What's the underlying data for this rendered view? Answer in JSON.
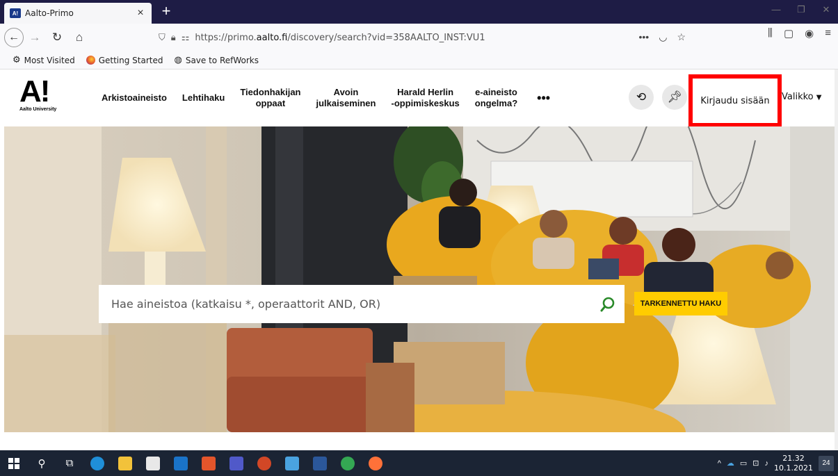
{
  "browser": {
    "tab_title": "Aalto-Primo",
    "tab_favicon_text": "A!",
    "tab_close": "×",
    "new_tab": "+",
    "url_prefix": "https://primo.",
    "url_domain": "aalto.fi",
    "url_suffix": "/discovery/search?vid=358AALTO_INST:VU1",
    "url_more": "•••",
    "bookmarks": [
      {
        "label": "Most Visited",
        "icon": "gear-icon"
      },
      {
        "label": "Getting Started",
        "icon": "firefox-icon"
      },
      {
        "label": "Save to RefWorks",
        "icon": "globe-icon"
      }
    ]
  },
  "site": {
    "logo_mark": "A!",
    "logo_sub": "Aalto University",
    "nav": [
      {
        "label": "Arkistoaineisto"
      },
      {
        "label": "Lehtihaku"
      },
      {
        "label": "Tiedonhakijan\noppaat"
      },
      {
        "label": "Avoin\njulkaiseminen"
      },
      {
        "label": "Harald Herlin\n-oppimiskeskus"
      },
      {
        "label": "e-aineisto\nongelma?"
      }
    ],
    "nav_more": "•••",
    "login_label": "Kirjaudu sisään",
    "menu_label": "Valikko"
  },
  "search": {
    "placeholder": "Hae aineistoa (katkaisu *, operaattorit AND, OR)",
    "advanced_label": "TARKENNETTU HAKU"
  },
  "taskbar": {
    "time": "21.32",
    "date": "10.1.2021",
    "notifications": "24"
  },
  "colors": {
    "accent_yellow": "#ffcc00",
    "search_icon_green": "#2a8a2a",
    "highlight_red": "#ff0000",
    "titlebar": "#1e1c45"
  }
}
